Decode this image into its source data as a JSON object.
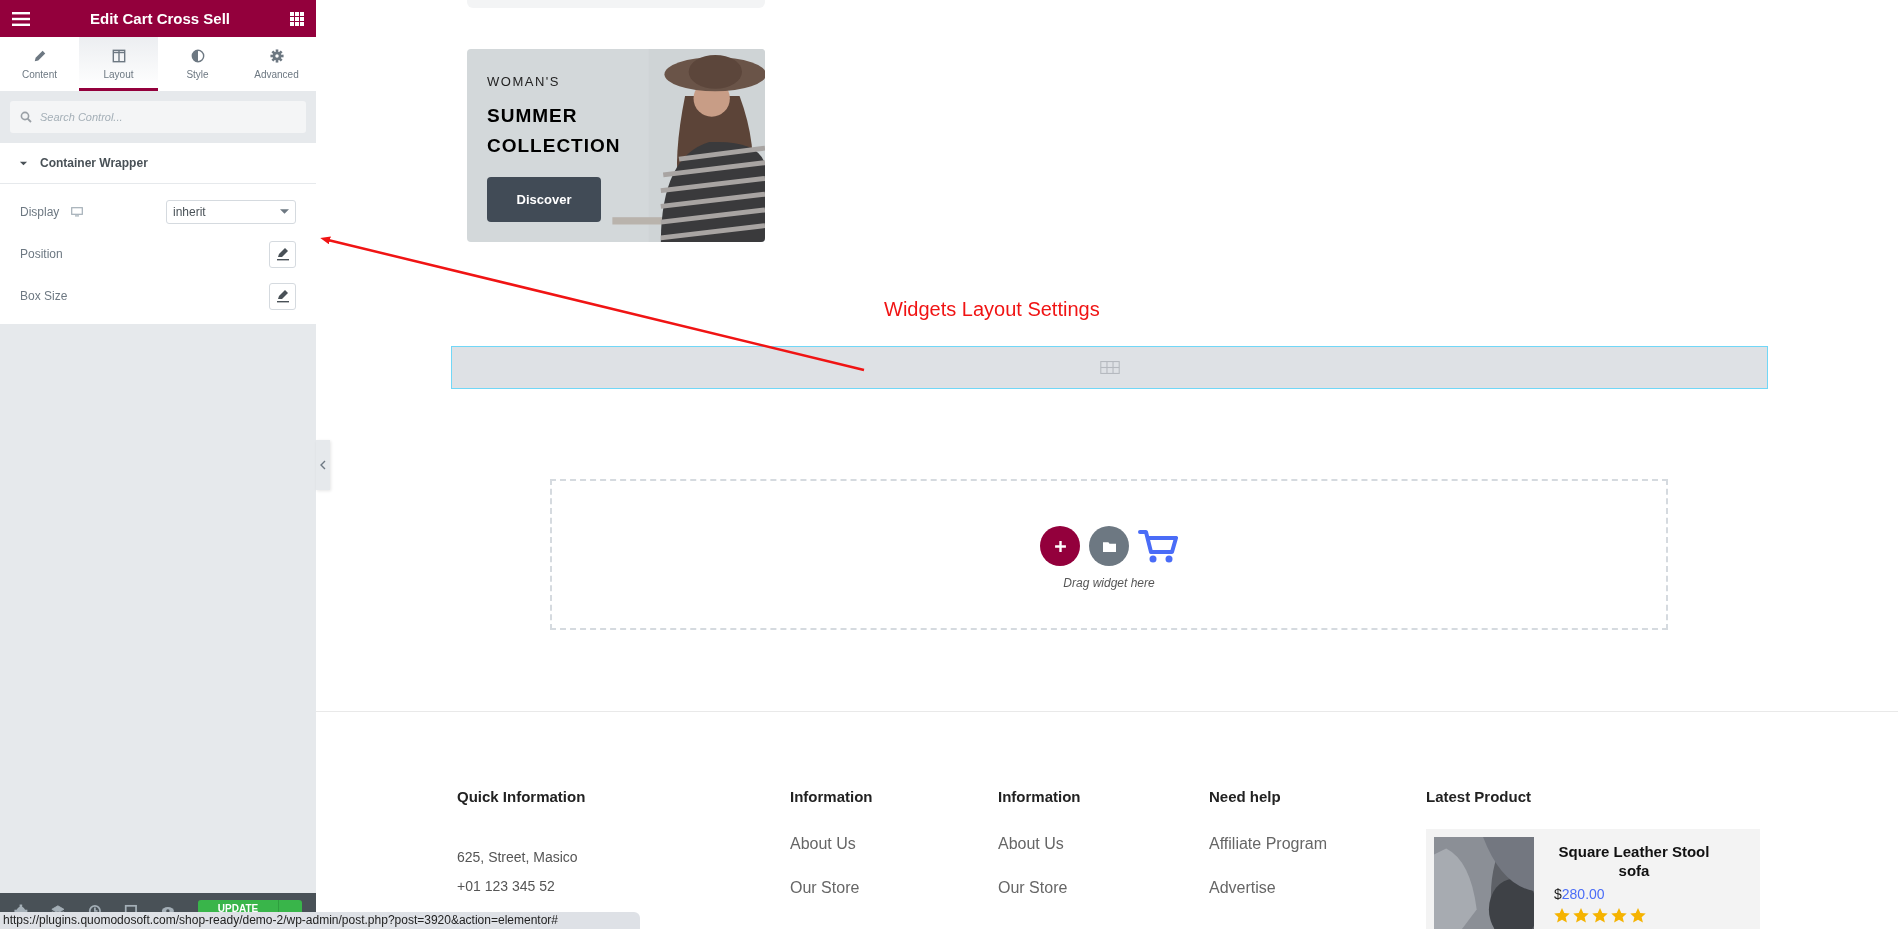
{
  "panel": {
    "title": "Edit Cart Cross Sell",
    "tabs": [
      {
        "label": "Content",
        "selected": false
      },
      {
        "label": "Layout",
        "selected": true
      },
      {
        "label": "Style",
        "selected": false
      },
      {
        "label": "Advanced",
        "selected": false
      }
    ],
    "search": {
      "placeholder": "Search Control..."
    },
    "section": {
      "title": "Container Wrapper",
      "expanded": true
    },
    "controls": [
      {
        "kind": "select",
        "label": "Display",
        "value": "inherit"
      },
      {
        "kind": "edit",
        "label": "Position"
      },
      {
        "kind": "edit",
        "label": "Box Size"
      }
    ],
    "update_button": "UPDATE"
  },
  "status_url": "https://plugins.quomodosoft.com/shop-ready/demo-2/wp-admin/post.php?post=3920&action=elementor#",
  "canvas": {
    "banner": {
      "eyebrow": "WOMAN'S",
      "title_lines": [
        "SUMMER",
        "COLLECTION"
      ],
      "button": "Discover"
    },
    "annotation": "Widgets Layout Settings",
    "drop_zone": {
      "hint": "Drag widget here"
    }
  },
  "footer": {
    "columns": [
      {
        "kind": "info",
        "heading": "Quick Information",
        "items": [
          "625, Street, Masico",
          "+01 123 345 52"
        ]
      },
      {
        "kind": "links",
        "heading": "Information",
        "items": [
          "About Us",
          "Our Store"
        ]
      },
      {
        "kind": "links",
        "heading": "Information",
        "items": [
          "About Us",
          "Our Store"
        ]
      },
      {
        "kind": "links",
        "heading": "Need help",
        "items": [
          "Affiliate Program",
          "Advertise"
        ]
      }
    ],
    "latest": {
      "heading": "Latest Product",
      "product": {
        "name": "Square Leather Stool sofa",
        "currency": "$",
        "price": "280.00",
        "stars": 5
      }
    }
  }
}
